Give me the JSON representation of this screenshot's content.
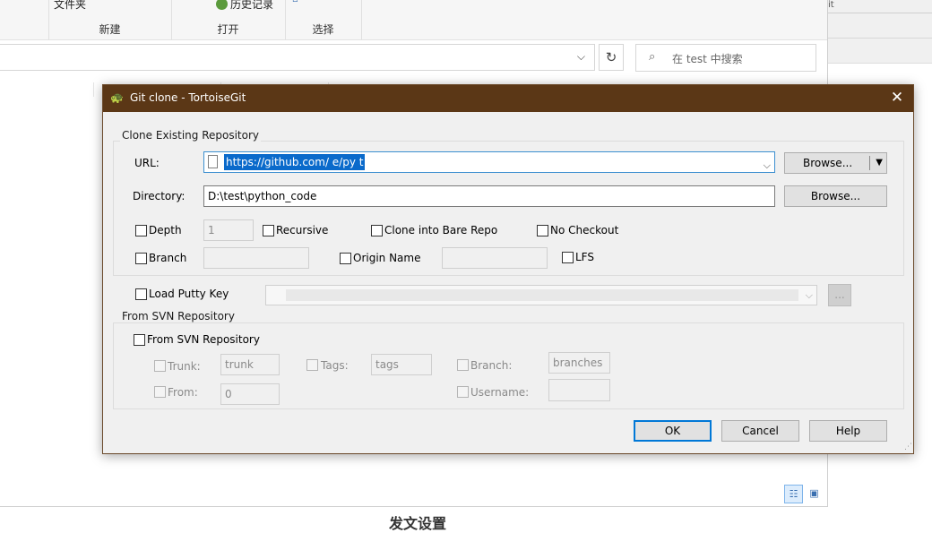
{
  "explorer": {
    "ribbon": {
      "groups": [
        {
          "top": "文件夹",
          "caption": "新建"
        },
        {
          "top": "历史记录",
          "caption": "打开"
        },
        {
          "top": "",
          "caption": "选择"
        }
      ]
    },
    "search_placeholder": "在 test 中搜索",
    "right_panel_text": "it",
    "bottom_caption": "发文设置"
  },
  "dialog": {
    "title": "Git clone - TortoiseGit",
    "clone_group": "Clone Existing Repository",
    "url_label": "URL:",
    "url_value": "https://github.com/ e/py t",
    "directory_label": "Directory:",
    "directory_value": "D:\\test\\python_code",
    "browse_label": "Browse...",
    "depth_label": "Depth",
    "depth_value": "1",
    "recursive_label": "Recursive",
    "bare_label": "Clone into Bare Repo",
    "no_checkout_label": "No Checkout",
    "branch_label": "Branch",
    "origin_label": "Origin Name",
    "lfs_label": "LFS",
    "putty_label": "Load Putty Key",
    "putty_browse": "...",
    "svn_group": "From SVN Repository",
    "svn_checkbox": "From SVN Repository",
    "trunk_label": "Trunk:",
    "trunk_value": "trunk",
    "tags_label": "Tags:",
    "tags_value": "tags",
    "svn_branch_label": "Branch:",
    "svn_branch_value": "branches",
    "from_label": "From:",
    "from_value": "0",
    "username_label": "Username:",
    "ok": "OK",
    "cancel": "Cancel",
    "help": "Help"
  }
}
